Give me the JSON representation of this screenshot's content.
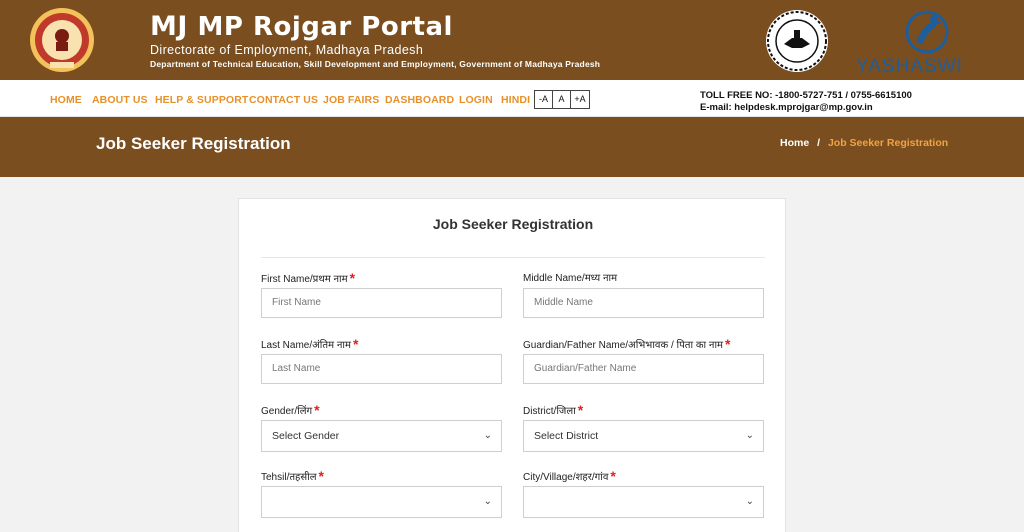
{
  "header": {
    "brand_title": "MP Rojgar Portal",
    "brand_mark": "MJ",
    "subtitle": "Directorate of Employment, Madhaya Pradesh",
    "department": "Department of Technical Education, Skill Development and Employment, Government of Madhaya Pradesh",
    "emblem_text": "सत्यमेव जयते",
    "partner_logo_text": "YASHASWI",
    "seal_text": "FOR EMPLOYERS AND EMPLOYMENT SEEKERS",
    "colors": {
      "header_bg": "#7a4e1f",
      "accent": "#e8912a",
      "required": "#e02020"
    }
  },
  "nav": {
    "items": [
      "HOME",
      "ABOUT US",
      "HELP & SUPPORT",
      "CONTACT US",
      "JOB FAIRS",
      "DASHBOARD",
      "LOGIN",
      "HINDI"
    ],
    "font_buttons": [
      "-A",
      "A",
      "+A"
    ],
    "toll_free": "TOLL FREE NO: -1800-5727-751 / 0755-6615100",
    "email": "E-mail: helpdesk.mprojgar@mp.gov.in"
  },
  "banner": {
    "title": "Job Seeker Registration",
    "breadcrumb": {
      "home": "Home",
      "separator": "/",
      "current": "Job Seeker Registration"
    }
  },
  "form": {
    "title": "Job Seeker Registration",
    "required_mark": "*",
    "fields": {
      "first_name": {
        "label": "First Name/प्रथम नाम",
        "placeholder": "First Name"
      },
      "middle_name": {
        "label": "Middle Name/मध्य नाम",
        "placeholder": "Middle Name"
      },
      "last_name": {
        "label": "Last Name/अंतिम नाम",
        "placeholder": "Last Name"
      },
      "guardian_name": {
        "label": "Guardian/Father Name/अभिभावक / पिता का नाम",
        "placeholder": "Guardian/Father Name"
      },
      "gender": {
        "label": "Gender/लिंग",
        "selected": "Select Gender"
      },
      "district": {
        "label": "District/जिला",
        "selected": "Select District"
      },
      "tehsil": {
        "label": "Tehsil/तहसील",
        "selected": ""
      },
      "city": {
        "label": "City/Village/शहर/गांव",
        "selected": ""
      }
    }
  }
}
